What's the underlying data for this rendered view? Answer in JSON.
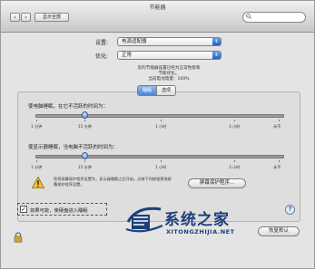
{
  "window": {
    "title": "节能器"
  },
  "toolbar": {
    "back_icon": "chevron-left-icon",
    "forward_icon": "chevron-right-icon",
    "show_all_label": "显示全部",
    "search_icon": "search-icon",
    "search_value": ""
  },
  "settings": {
    "settings_label": "设置:",
    "settings_value": "电源适配器",
    "optimize_label": "优化:",
    "optimize_value": "正常",
    "info_line1": "您的节能器设置已经为正常性能和",
    "info_line2": "节能优化。",
    "battery_status": "当前电池电量：100%"
  },
  "tabs": [
    {
      "label": "睡眠",
      "selected": true
    },
    {
      "label": "选项",
      "selected": false
    }
  ],
  "computer_sleep": {
    "label": "使电脑睡眠，在它不活跃的时间为：",
    "level_minutes": 15,
    "ticks": [
      "1 分钟",
      "15 分钟",
      "1 小时",
      "3 小时",
      "永不"
    ]
  },
  "display_sleep": {
    "label": "使显示器睡眠，当电脑不活跃的时间为：",
    "level_minutes": 15,
    "ticks": [
      "1 分钟",
      "15 分钟",
      "1 小时",
      "3 小时",
      "永不"
    ]
  },
  "warning": {
    "icon": "warning-icon",
    "text": "您将屏幕保护程序设置为，显示器睡眠之后开始。点按下列按钮更改屏幕保护程序设置。"
  },
  "buttons": {
    "screensaver": "屏幕保护程序...",
    "restore_defaults": "恢复默认"
  },
  "checkbox": {
    "label": "如果可能，使硬盘进入睡眠",
    "checked": true
  },
  "help_icon": "question-mark-icon",
  "lock_icon": "lock-icon",
  "watermark": {
    "title": "系统之家",
    "subtitle": "XITONGZHIJIA.NET"
  },
  "colors": {
    "accent": "#2f6fd6",
    "watermark": "#1d3f7a"
  }
}
